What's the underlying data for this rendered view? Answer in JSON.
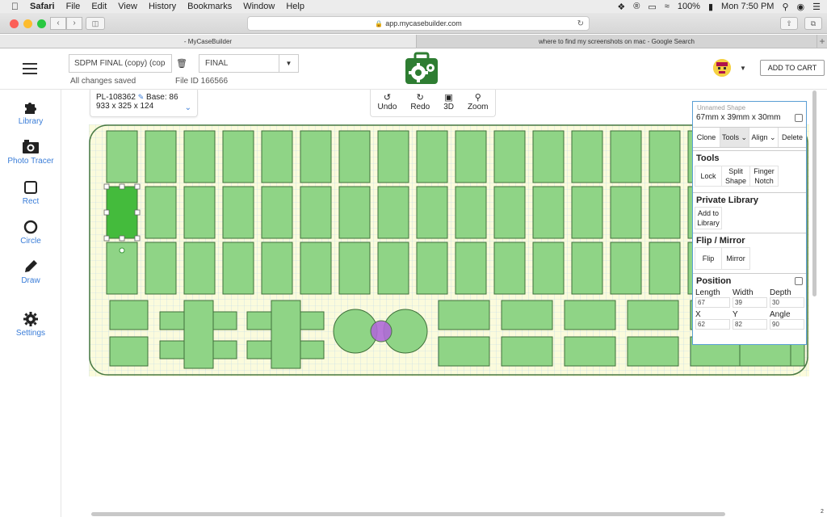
{
  "menubar": {
    "app": "Safari",
    "items": [
      "File",
      "Edit",
      "View",
      "History",
      "Bookmarks",
      "Window",
      "Help"
    ],
    "battery": "100%",
    "clock": "Mon 7:50 PM"
  },
  "browser": {
    "url": "app.mycasebuilder.com",
    "tabs": [
      {
        "label": "- MyCaseBuilder",
        "active": true
      },
      {
        "label": "where to find my screenshots on mac - Google Search",
        "active": false
      }
    ]
  },
  "header": {
    "project_name": "SDPM FINAL (copy) (cop",
    "status_value": "FINAL",
    "saved_text": "All changes saved",
    "file_id": "File ID 166566",
    "cart_button": "ADD TO CART"
  },
  "sidebar": {
    "items": [
      {
        "label": "Library",
        "icon": "puzzle-icon"
      },
      {
        "label": "Photo Tracer",
        "icon": "camera-icon"
      },
      {
        "label": "Rect",
        "icon": "rect-icon"
      },
      {
        "label": "Circle",
        "icon": "circle-icon"
      },
      {
        "label": "Draw",
        "icon": "pencil-icon"
      },
      {
        "label": "Settings",
        "icon": "gear-icon"
      }
    ]
  },
  "info_card": {
    "part_id": "PL-108362",
    "base": "Base: 86",
    "dims": "933 x 325 x 124"
  },
  "toolbar": {
    "undo": "Undo",
    "redo": "Redo",
    "three_d": "3D",
    "zoom": "Zoom"
  },
  "panel": {
    "shape_label": "Unnamed Shape",
    "dims": "67mm x 39mm x 30mm",
    "actions": {
      "clone": "Clone",
      "tools": "Tools",
      "align": "Align",
      "delete": "Delete"
    },
    "tools_section": {
      "title": "Tools",
      "lock": "Lock",
      "split": "Split Shape",
      "finger": "Finger Notch"
    },
    "library_section": {
      "title": "Private Library",
      "add": "Add to Library"
    },
    "flip_section": {
      "title": "Flip / Mirror",
      "flip": "Flip",
      "mirror": "Mirror"
    },
    "position_section": {
      "title": "Position",
      "length_label": "Length",
      "width_label": "Width",
      "depth_label": "Depth",
      "length": "67",
      "width": "39",
      "depth": "30",
      "x_label": "X",
      "y_label": "Y",
      "angle_label": "Angle",
      "x": "62",
      "y": "82",
      "angle": "90"
    }
  },
  "colors": {
    "pocket_fill": "#8fd486",
    "pocket_stroke": "#3f6f3a",
    "selected_fill": "#44bb3c",
    "accent": "#3a7dd8",
    "foam_bg": "#fbfbdc"
  }
}
